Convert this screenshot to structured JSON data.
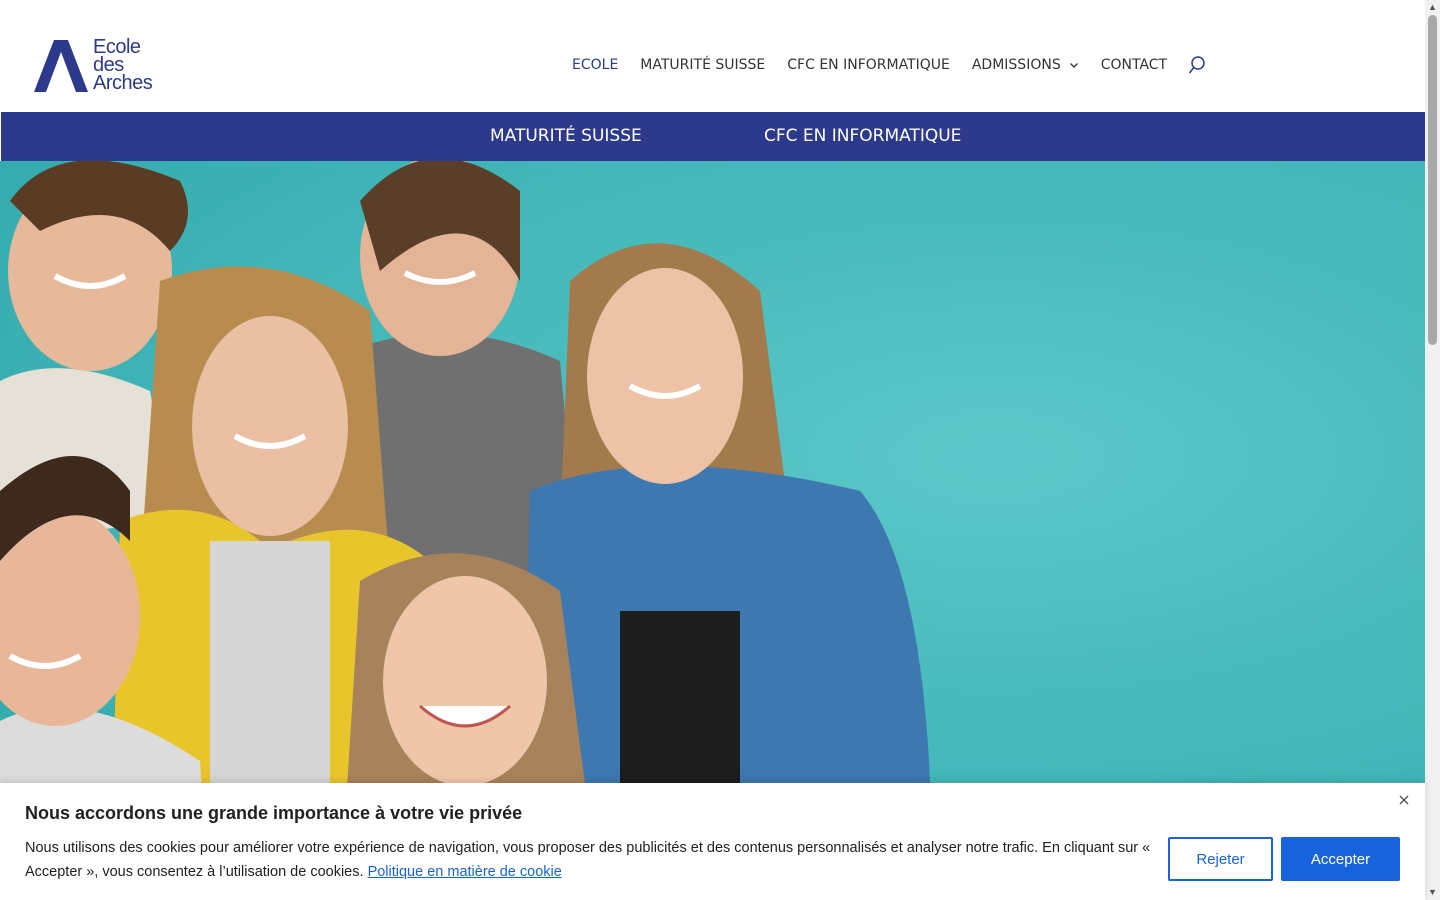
{
  "brand": {
    "logo_lines": [
      "Ecole",
      "des",
      "Arches"
    ],
    "color": "#2d3a8c"
  },
  "nav": {
    "items": [
      {
        "label": "ECOLE",
        "active": true
      },
      {
        "label": "MATURITÉ SUISSE",
        "active": false
      },
      {
        "label": "CFC EN INFORMATIQUE",
        "active": false
      },
      {
        "label": "ADMISSIONS",
        "active": false,
        "has_dropdown": true
      },
      {
        "label": "CONTACT",
        "active": false
      }
    ],
    "search_icon": "search-icon",
    "active_color": "#2d3a8c"
  },
  "subnav": {
    "background": "#2d3a8c",
    "links": [
      "MATURITÉ SUISSE",
      "CFC EN INFORMATIQUE"
    ]
  },
  "hero": {
    "background": "#46b9bb"
  },
  "cookie": {
    "title": "Nous accordons une grande importance à votre vie privée",
    "text": "Nous utilisons des cookies pour améliorer votre expérience de navigation, vous proposer des publicités et des contenus personnalisés et analyser notre trafic. En cliquant sur « Accepter », vous consentez à l’utilisation de cookies.",
    "policy_link": "Politique en matière de cookie",
    "reject_label": "Rejeter",
    "accept_label": "Accepter",
    "accent": "#1863dc"
  }
}
